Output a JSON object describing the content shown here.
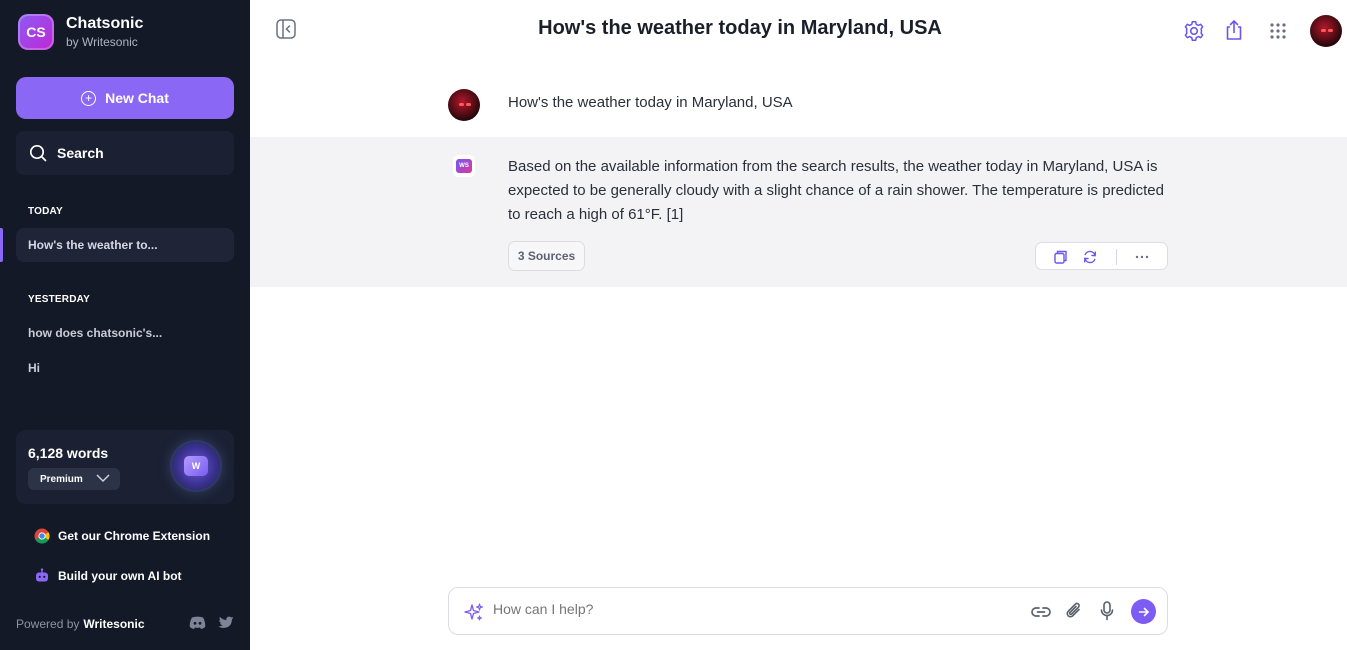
{
  "sidebar": {
    "brand": {
      "logo_text": "CS",
      "name": "Chatsonic",
      "subtitle": "by Writesonic"
    },
    "new_chat_label": "New Chat",
    "search_label": "Search",
    "sections": [
      {
        "label": "TODAY",
        "items": [
          {
            "label": "How's the weather to...",
            "active": true
          }
        ]
      },
      {
        "label": "YESTERDAY",
        "items": [
          {
            "label": "how does chatsonic's...",
            "active": false
          },
          {
            "label": "Hi",
            "active": false
          }
        ]
      }
    ],
    "usage": {
      "words": "6,128 words",
      "plan": "Premium",
      "orb_text": "W"
    },
    "links": [
      {
        "label": "Get our Chrome Extension",
        "icon": "chrome-icon"
      },
      {
        "label": "Build your own AI bot",
        "icon": "bot-icon"
      }
    ],
    "footer": {
      "prefix": "Powered by",
      "brand": "Writesonic"
    }
  },
  "header": {
    "title": "How's the weather today in Maryland, USA"
  },
  "conversation": {
    "user_message": "How's the weather today in Maryland, USA",
    "ai_logo_text": "WS",
    "ai_message": "Based on the available information from the search results, the weather today in Maryland, USA is expected to be generally cloudy with a slight chance of a rain shower. The temperature is predicted to reach a high of 61°F. [1]",
    "sources_label": "3 Sources"
  },
  "composer": {
    "placeholder": "How can I help?"
  },
  "colors": {
    "sidebar_bg": "#141927",
    "accent": "#8b67f6",
    "ai_row_bg": "#f3f3f5"
  }
}
